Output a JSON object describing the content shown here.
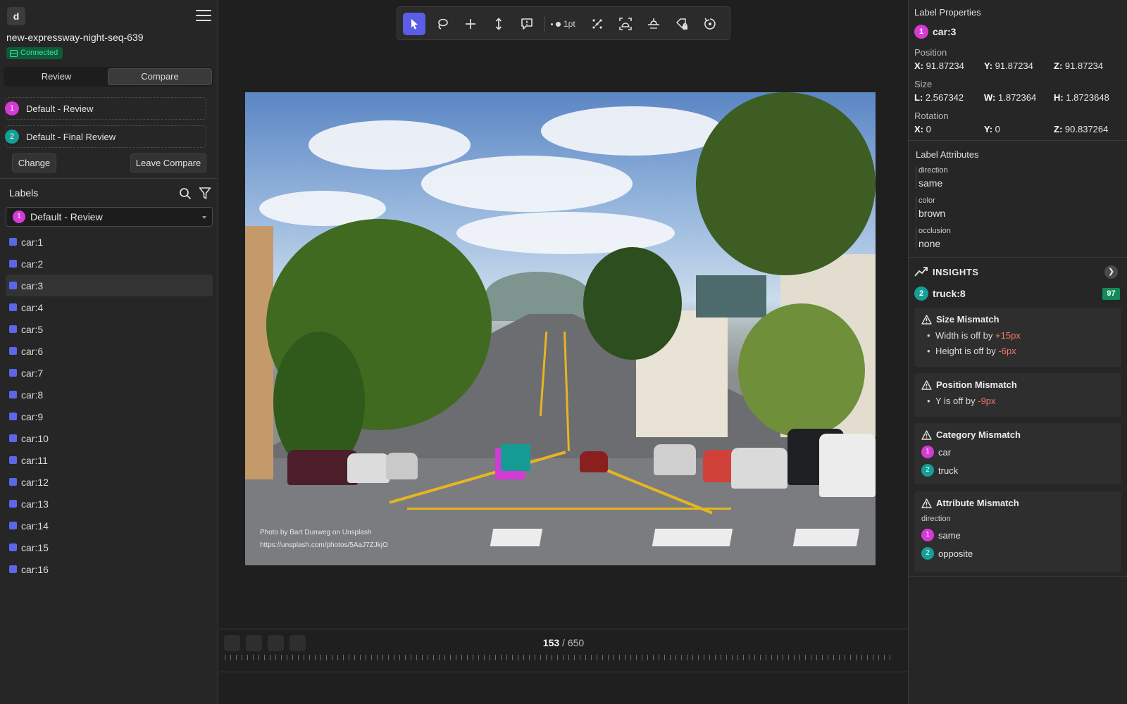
{
  "app": {
    "logo": "d",
    "sequence_name": "new-expressway-night-seq-639",
    "status": "Connected"
  },
  "mode_tabs": [
    "Review",
    "Compare"
  ],
  "active_tab": "Compare",
  "compare": {
    "items": [
      {
        "num": "1",
        "name": "Default - Review"
      },
      {
        "num": "2",
        "name": "Default - Final Review"
      }
    ],
    "change_label": "Change",
    "leave_label": "Leave Compare"
  },
  "labels_panel": {
    "title": "Labels",
    "selected_set": {
      "num": "1",
      "name": "Default - Review"
    },
    "items": [
      "car:1",
      "car:2",
      "car:3",
      "car:4",
      "car:5",
      "car:6",
      "car:7",
      "car:8",
      "car:9",
      "car:10",
      "car:11",
      "car:12",
      "car:13",
      "car:14",
      "car:15",
      "car:16"
    ],
    "selected_item": "car:3"
  },
  "toolbar": {
    "tools": [
      "select-arrow",
      "lasso",
      "crosshair",
      "vertical-arrows",
      "comment",
      "point-size",
      "magic-points",
      "scan-view",
      "ground-plane",
      "lock-label",
      "reset"
    ],
    "point_size": "1pt"
  },
  "viewer": {
    "credit_line1": "Photo by Bart Dunweg on Unsplash",
    "credit_line2": "https://unsplash.com/photos/5AaJ7ZJkjO"
  },
  "timeline": {
    "current_frame": "153",
    "total_frames": "/ 650"
  },
  "properties": {
    "title": "Label Properties",
    "label_num": "1",
    "label_name": "car:3",
    "position_title": "Position",
    "position": {
      "x": "91.87234",
      "y": "91.87234",
      "z": "91.87234"
    },
    "size_title": "Size",
    "size": {
      "l": "2.567342",
      "w": "1.872364",
      "h": "1.8723648"
    },
    "rotation_title": "Rotation",
    "rotation": {
      "x": "0",
      "y": "0",
      "z": "90.837264"
    },
    "keys": {
      "x": "X:",
      "y": "Y:",
      "z": "Z:",
      "l": "L:",
      "w": "W:",
      "h": "H:"
    }
  },
  "attributes": {
    "title": "Label Attributes",
    "items": [
      {
        "key": "direction",
        "value": "same"
      },
      {
        "key": "color",
        "value": "brown"
      },
      {
        "key": "occlusion",
        "value": "none"
      }
    ]
  },
  "insights": {
    "title": "INSIGHTS",
    "label_num": "2",
    "label_name": "truck:8",
    "score": "97",
    "size_mismatch": {
      "title": "Size Mismatch",
      "items": [
        {
          "text": "Width is off by",
          "delta": "+15px"
        },
        {
          "text": "Height is off by",
          "delta": "-6px"
        }
      ]
    },
    "position_mismatch": {
      "title": "Position Mismatch",
      "items": [
        {
          "text": "Y is off by",
          "delta": "-9px"
        }
      ]
    },
    "category_mismatch": {
      "title": "Category Mismatch",
      "a": {
        "num": "1",
        "value": "car"
      },
      "b": {
        "num": "2",
        "value": "truck"
      }
    },
    "attribute_mismatch": {
      "title": "Attribute Mismatch",
      "attr": "direction",
      "a": {
        "num": "1",
        "value": "same"
      },
      "b": {
        "num": "2",
        "value": "opposite"
      }
    }
  },
  "colors": {
    "accent": "#5b5de6",
    "set1": "#d63ad6",
    "set2": "#159f96",
    "label_square": "#5b67e8",
    "connected": "#3de294",
    "score_bg": "#138a58",
    "delta": "#f2766a"
  }
}
